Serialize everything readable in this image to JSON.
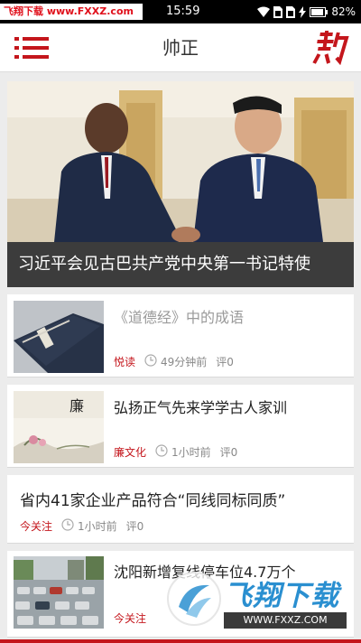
{
  "status_bar": {
    "watermark": "飞翔下载 www.FXXZ.com",
    "time": "15:59",
    "battery": "82%",
    "icons": [
      "wifi-icon",
      "sim-icon",
      "sim-icon",
      "charging-icon",
      "battery-icon"
    ]
  },
  "app_bar": {
    "title": "帅正",
    "menu_icon": "menu-icon",
    "logo_icon": "brand-logo-icon"
  },
  "hero": {
    "caption": "习近平会见古巴共产党中央第一书记特使"
  },
  "articles": [
    {
      "title": "《道德经》中的成语",
      "tag": "悦读",
      "time": "49分钟前",
      "comments": "评0",
      "read": true,
      "thumbnail": "book-thumbnail"
    },
    {
      "title": "弘扬正气先来学学古人家训",
      "tag": "廉文化",
      "time": "1小时前",
      "comments": "评0",
      "read": false,
      "thumbnail": "lian-painting-thumbnail"
    },
    {
      "title": "省内41家企业产品符合“同线同标同质”",
      "tag": "今关注",
      "time": "1小时前",
      "comments": "评0",
      "read": false
    },
    {
      "title": "沈阳新增复线停车位4.7万个",
      "tag": "今关注",
      "time": "",
      "comments": "",
      "read": false,
      "thumbnail": "parking-lot-thumbnail"
    }
  ],
  "thumb_texts": {
    "lian": "廉"
  },
  "watermark_bottom": {
    "text": "飞翔下载",
    "url": "WWW.FXXZ.COM"
  },
  "colors": {
    "accent": "#c4161c",
    "watermark_blue": "#2a8fd0"
  }
}
